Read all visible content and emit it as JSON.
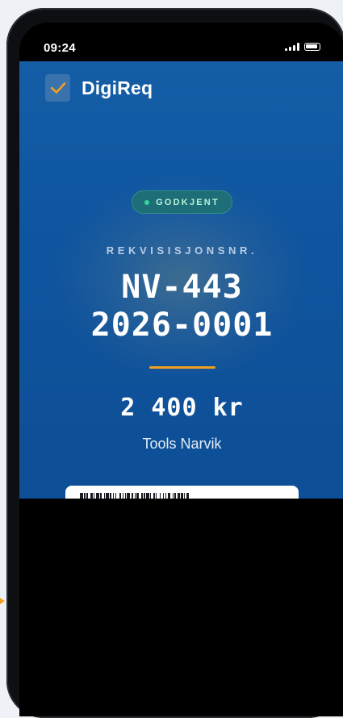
{
  "status_bar": {
    "time": "09:24"
  },
  "app": {
    "name": "DigiReq"
  },
  "requisition": {
    "status": "GODKJENT",
    "label": "REKVISISJONSNR.",
    "number_line1": "NV-443",
    "number_line2": "2026-0001",
    "amount": "2 400 kr",
    "vendor": "Tools Narvik"
  },
  "colors": {
    "accent": "#f0a020",
    "brand_blue": "#0f55a0",
    "status_green": "#33d69b"
  },
  "icons": [
    "check-icon",
    "signal-icon",
    "battery-icon",
    "barcode-icon"
  ]
}
